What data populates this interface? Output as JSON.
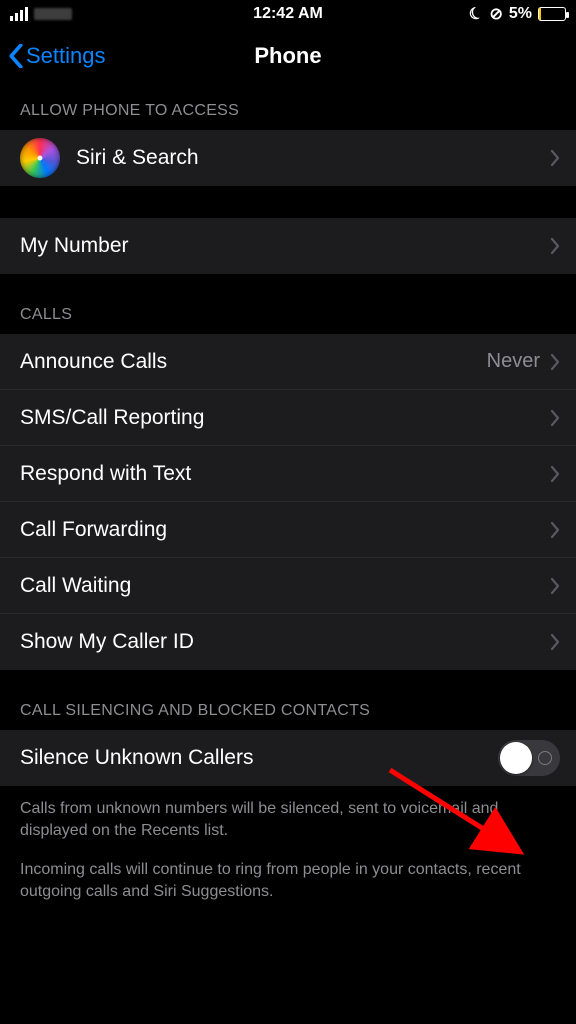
{
  "status": {
    "time": "12:42 AM",
    "moon_glyph": "☾",
    "lock_glyph": "⊘",
    "battery_percent": "5%"
  },
  "nav": {
    "back_label": "Settings",
    "title": "Phone"
  },
  "sections": {
    "allow_access_header": "ALLOW PHONE TO ACCESS",
    "siri_search_label": "Siri & Search",
    "my_number_label": "My Number",
    "calls_header": "CALLS",
    "announce_calls_label": "Announce Calls",
    "announce_calls_value": "Never",
    "sms_call_reporting_label": "SMS/Call Reporting",
    "respond_text_label": "Respond with Text",
    "call_forwarding_label": "Call Forwarding",
    "call_waiting_label": "Call Waiting",
    "show_caller_id_label": "Show My Caller ID",
    "silencing_header": "CALL SILENCING AND BLOCKED CONTACTS",
    "silence_unknown_label": "Silence Unknown Callers",
    "silence_unknown_on": false,
    "footer1": "Calls from unknown numbers will be silenced, sent to voicemail and displayed on the Recents list.",
    "footer2": "Incoming calls will continue to ring from people in your contacts, recent outgoing calls and Siri Suggestions."
  },
  "colors": {
    "accent": "#0a84ff",
    "annotation": "#ff0000"
  }
}
